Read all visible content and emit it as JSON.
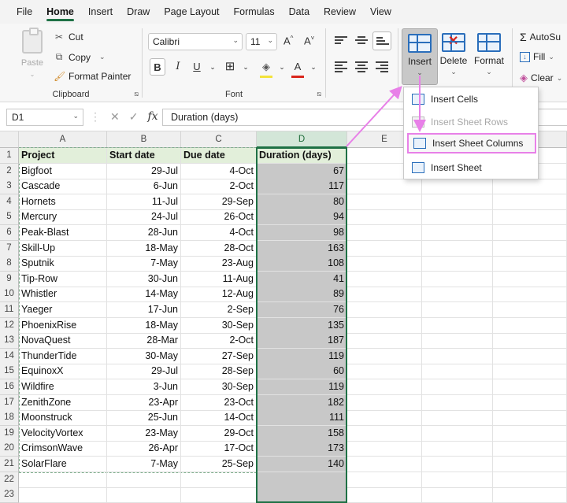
{
  "menu": {
    "tabs": [
      "File",
      "Home",
      "Insert",
      "Draw",
      "Page Layout",
      "Formulas",
      "Data",
      "Review",
      "View"
    ],
    "active": "Home"
  },
  "ribbon": {
    "clipboard": {
      "paste": "Paste",
      "cut": "Cut",
      "copy": "Copy",
      "format_painter": "Format Painter",
      "label": "Clipboard"
    },
    "font": {
      "family": "Calibri",
      "size": "11",
      "grow": "A^",
      "shrink": "A˅",
      "bold": "B",
      "italic": "I",
      "underline": "U",
      "label": "Font"
    },
    "cells": {
      "insert": "Insert",
      "delete": "Delete",
      "format": "Format"
    },
    "editing": {
      "autosum": "AutoSu",
      "fill": "Fill",
      "clear": "Clear"
    }
  },
  "formula_bar": {
    "name_box": "D1",
    "formula": "Duration (days)",
    "fx": "fx"
  },
  "insert_menu": {
    "items": [
      {
        "label": "Insert Cells",
        "disabled": false,
        "highlighted": false
      },
      {
        "label": "Insert Sheet Rows",
        "disabled": true,
        "highlighted": false
      },
      {
        "label": "Insert Sheet Columns",
        "disabled": false,
        "highlighted": true
      },
      {
        "label": "Insert Sheet",
        "disabled": false,
        "highlighted": false
      }
    ]
  },
  "sheet": {
    "columns": [
      "A",
      "B",
      "C",
      "D",
      "E"
    ],
    "headers": [
      "Project",
      "Start date",
      "Due date",
      "Duration (days)"
    ],
    "rows": [
      [
        "Bigfoot",
        "29-Jul",
        "4-Oct",
        "67"
      ],
      [
        "Cascade",
        "6-Jun",
        "2-Oct",
        "117"
      ],
      [
        "Hornets",
        "11-Jul",
        "29-Sep",
        "80"
      ],
      [
        "Mercury",
        "24-Jul",
        "26-Oct",
        "94"
      ],
      [
        "Peak-Blast",
        "28-Jun",
        "4-Oct",
        "98"
      ],
      [
        "Skill-Up",
        "18-May",
        "28-Oct",
        "163"
      ],
      [
        "Sputnik",
        "7-May",
        "23-Aug",
        "108"
      ],
      [
        "Tip-Row",
        "30-Jun",
        "11-Aug",
        "41"
      ],
      [
        "Whistler",
        "14-May",
        "12-Aug",
        "89"
      ],
      [
        "Yaeger",
        "17-Jun",
        "2-Sep",
        "76"
      ],
      [
        "PhoenixRise",
        "18-May",
        "30-Sep",
        "135"
      ],
      [
        "NovaQuest",
        "28-Mar",
        "2-Oct",
        "187"
      ],
      [
        "ThunderTide",
        "30-May",
        "27-Sep",
        "119"
      ],
      [
        "EquinoxX",
        "29-Jul",
        "28-Sep",
        "60"
      ],
      [
        "Wildfire",
        "3-Jun",
        "30-Sep",
        "119"
      ],
      [
        "ZenithZone",
        "23-Apr",
        "23-Oct",
        "182"
      ],
      [
        "Moonstruck",
        "25-Jun",
        "14-Oct",
        "111"
      ],
      [
        "VelocityVortex",
        "23-May",
        "29-Oct",
        "158"
      ],
      [
        "CrimsonWave",
        "26-Apr",
        "17-Oct",
        "173"
      ],
      [
        "SolarFlare",
        "7-May",
        "25-Sep",
        "140"
      ]
    ],
    "row_numbers": [
      "1",
      "2",
      "3",
      "4",
      "5",
      "6",
      "7",
      "8",
      "9",
      "10",
      "11",
      "12",
      "13",
      "14",
      "15",
      "16",
      "17",
      "18",
      "19",
      "20",
      "21",
      "22",
      "23"
    ],
    "selected_column": "D"
  },
  "colors": {
    "accent": "#1e7145",
    "highlight": "#e880e8",
    "header_fill": "#e2efda",
    "selection_fill": "#c8c8c8"
  }
}
